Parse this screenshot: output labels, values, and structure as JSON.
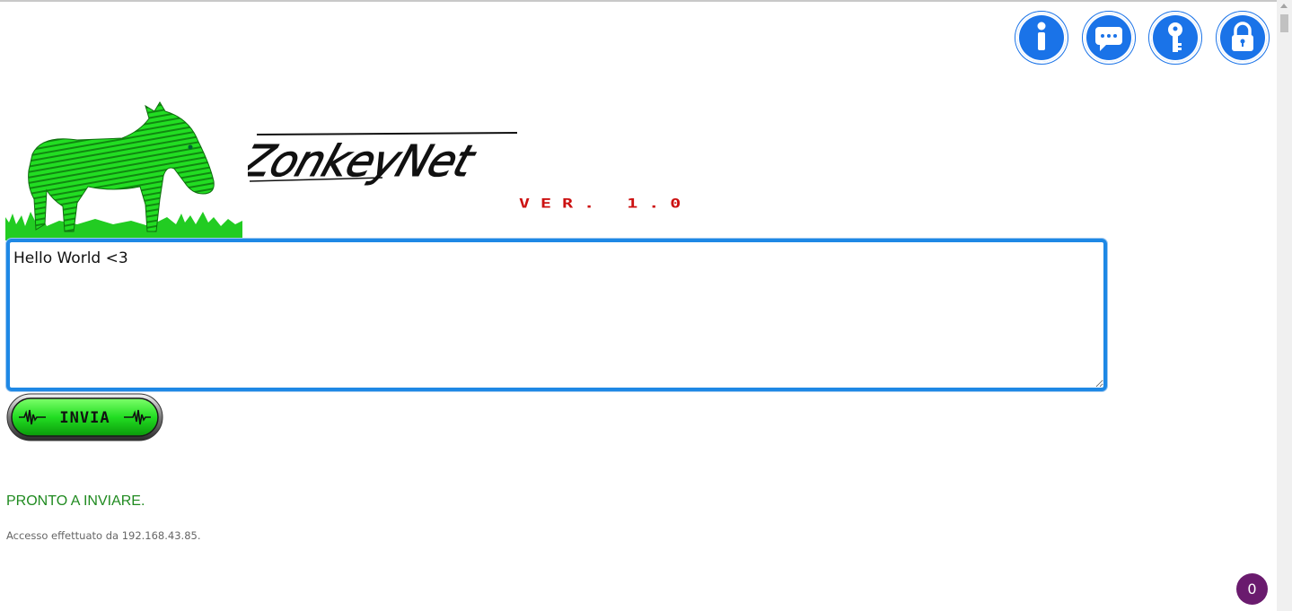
{
  "header": {
    "brand_name": "ZonkeyNet",
    "version": "VER. 1.0",
    "icons": [
      "info-icon",
      "chat-icon",
      "key-icon",
      "lock-icon"
    ]
  },
  "composer": {
    "message": "Hello World <3",
    "send_label": "INVIA"
  },
  "status": {
    "message": "PRONTO A INVIARE.",
    "access_text": "Accesso effettuato da 192.168.43.85."
  },
  "counter": {
    "count": "0"
  },
  "colors": {
    "accent": "#1a73e8",
    "status_green": "#1f8a1f",
    "version_red": "#cc1111",
    "donkey_green": "#22dd22",
    "counter_purple": "#6a1b6e"
  }
}
